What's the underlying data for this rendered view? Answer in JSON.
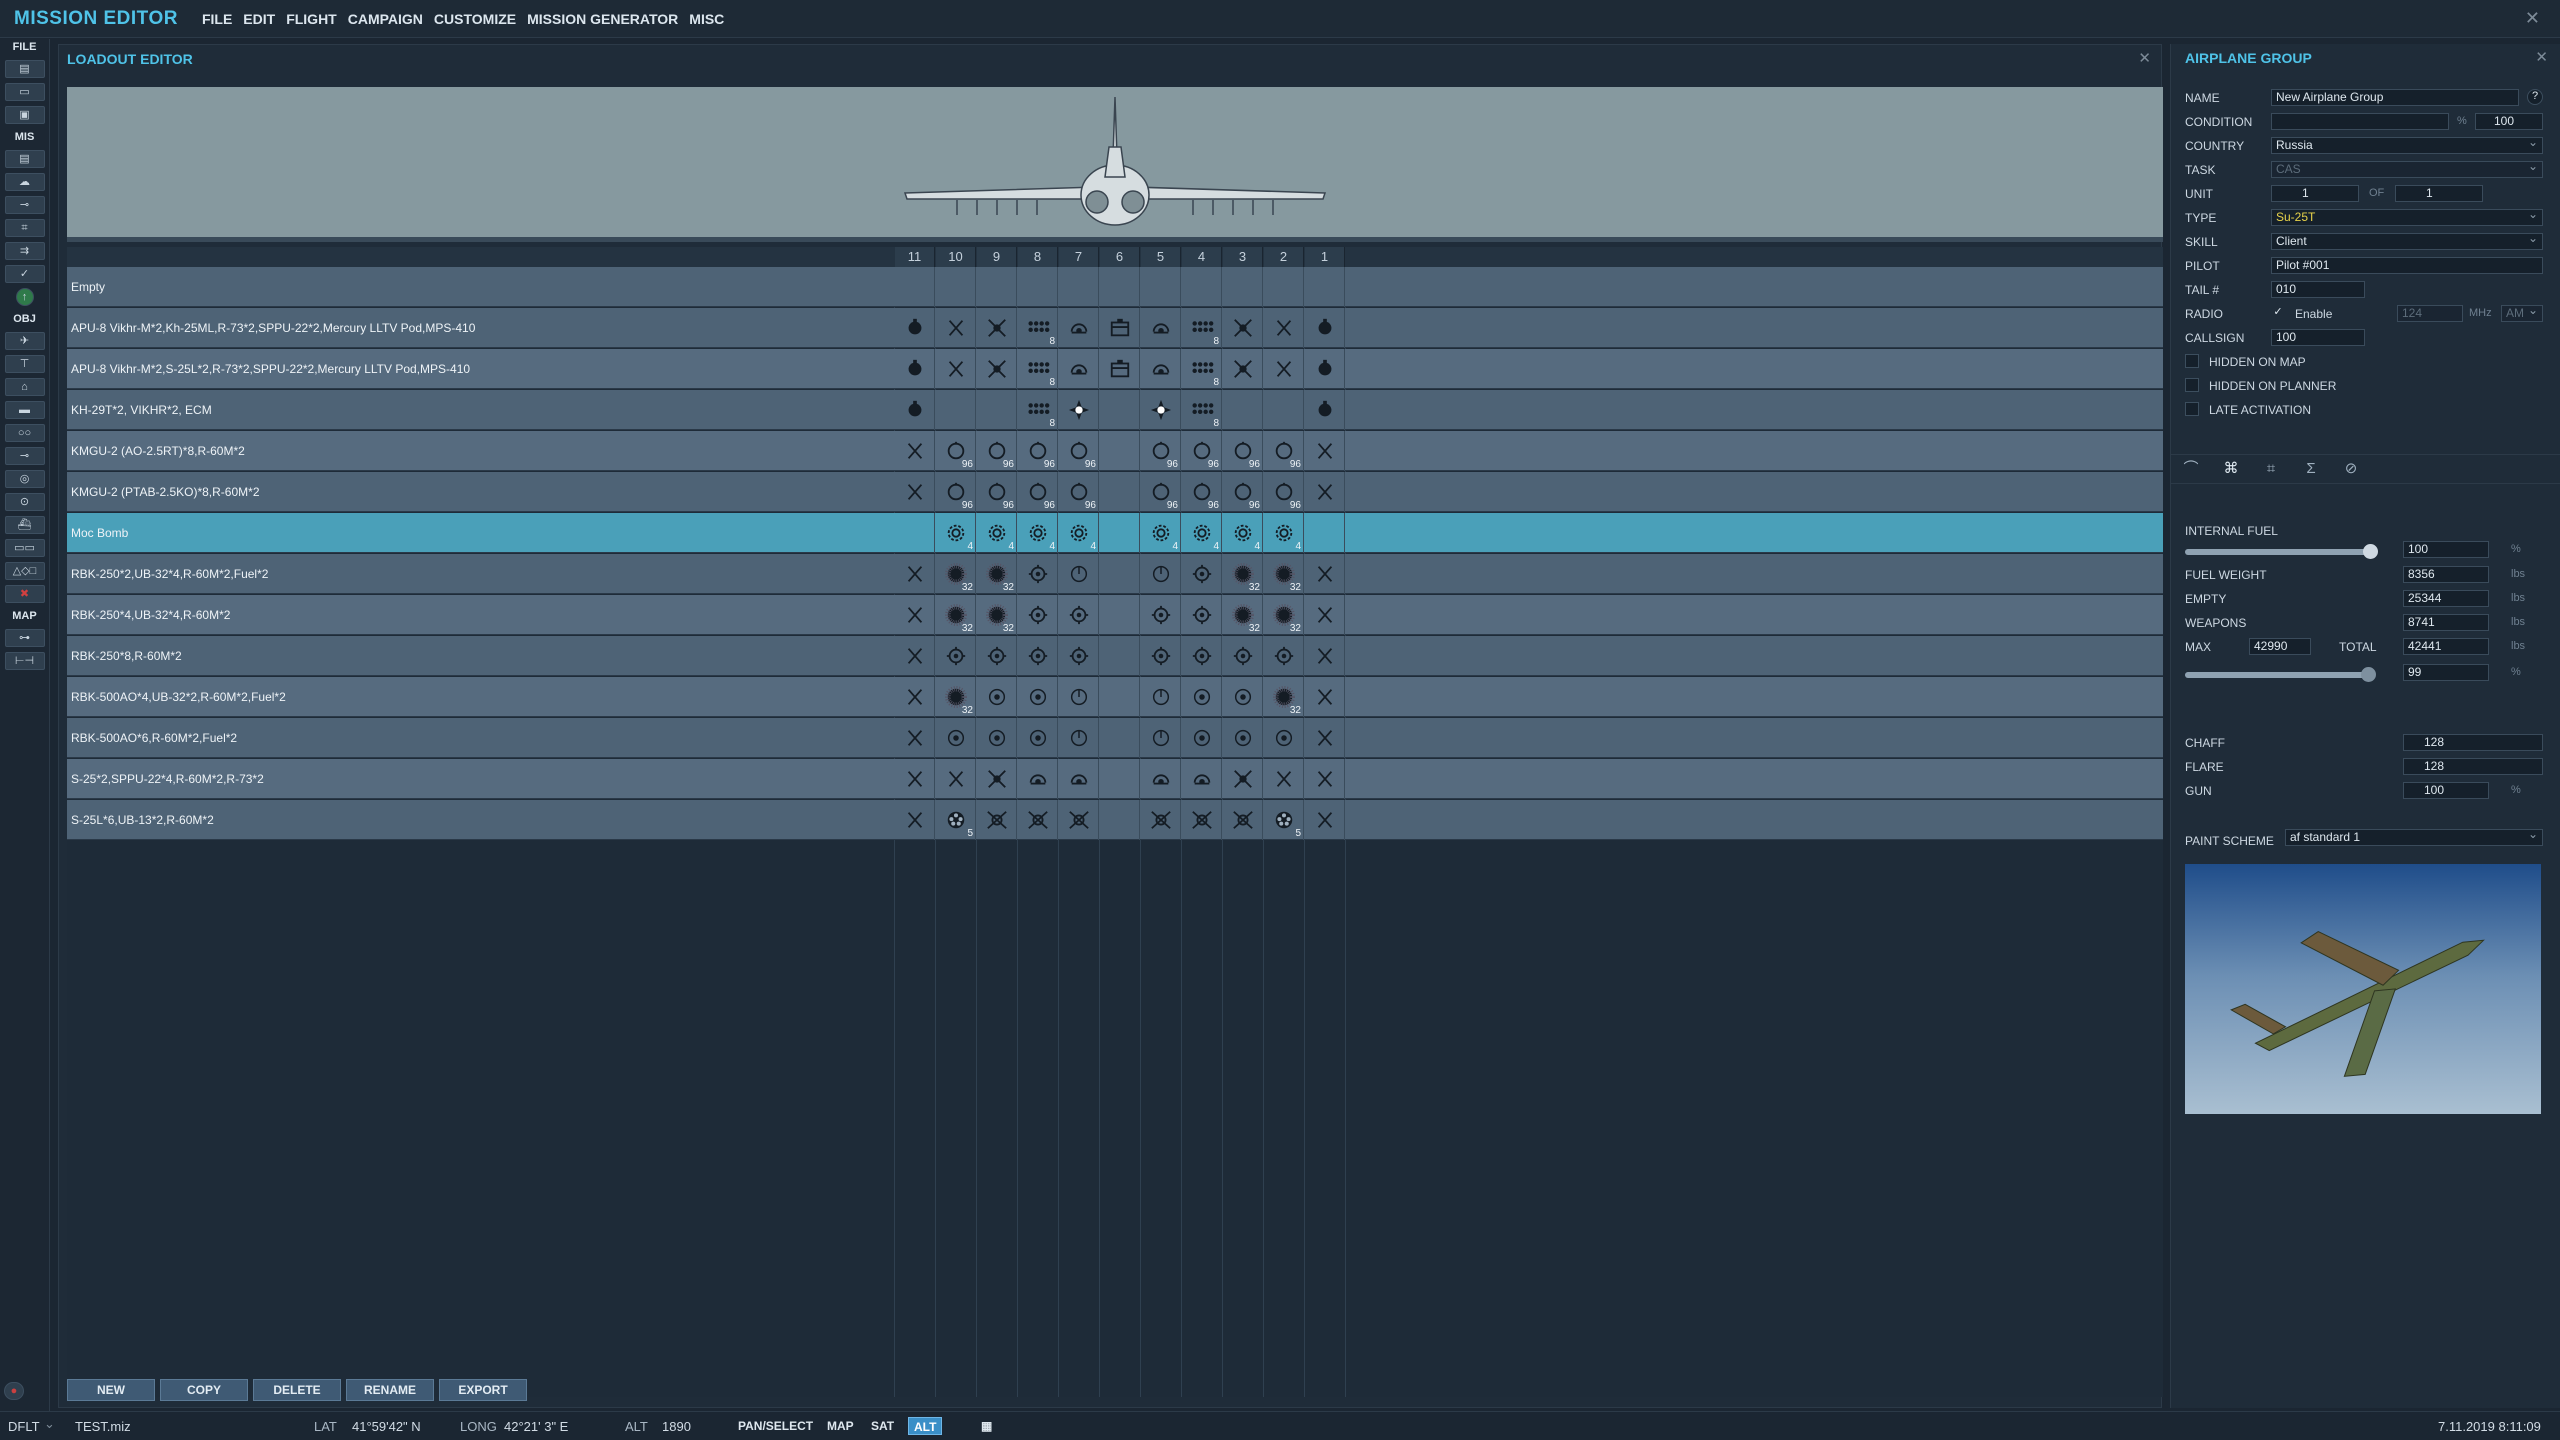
{
  "app": {
    "title": "MISSION EDITOR"
  },
  "menu": [
    "FILE",
    "EDIT",
    "FLIGHT",
    "CAMPAIGN",
    "CUSTOMIZE",
    "MISSION GENERATOR",
    "MISC"
  ],
  "toolbar": {
    "groups": [
      "FILE",
      "MIS",
      "OBJ",
      "MAP"
    ],
    "close": "✕"
  },
  "loadout": {
    "title": "LOADOUT EDITOR",
    "close": "✕",
    "stations": [
      "11",
      "10",
      "9",
      "8",
      "7",
      "6",
      "5",
      "4",
      "3",
      "2",
      "1"
    ],
    "rows": [
      {
        "name": "Empty",
        "slots": [
          "",
          "",
          "",
          "",
          "",
          "",
          "",
          "",
          "",
          "",
          ""
        ]
      },
      {
        "name": "APU-8 Vikhr-M*2,Kh-25ML,R-73*2,SPPU-22*2,Mercury LLTV Pod,MPS-410",
        "slots": [
          "bomb",
          "x",
          "xb",
          "rack8",
          "pod",
          "box",
          "pod",
          "rack8",
          "xb",
          "x",
          "bomb"
        ]
      },
      {
        "name": "APU-8 Vikhr-M*2,S-25L*2,R-73*2,SPPU-22*2,Mercury LLTV Pod,MPS-410",
        "slots": [
          "bomb",
          "x",
          "xb",
          "rack8",
          "pod",
          "box",
          "pod",
          "rack8",
          "xb",
          "x",
          "bomb"
        ]
      },
      {
        "name": "KH-29T*2, VIKHR*2, ECM",
        "slots": [
          "bomb",
          "",
          "",
          "rack8",
          "star",
          "",
          "star",
          "rack8",
          "",
          "",
          "bomb"
        ]
      },
      {
        "name": "KMGU-2 (AO-2.5RT)*8,R-60M*2",
        "slots": [
          "x",
          "pod96",
          "pod96",
          "pod96",
          "pod96",
          "",
          "pod96",
          "pod96",
          "pod96",
          "pod96",
          "x"
        ]
      },
      {
        "name": "KMGU-2 (PTAB-2.5KO)*8,R-60M*2",
        "slots": [
          "x",
          "pod96",
          "pod96",
          "pod96",
          "pod96",
          "",
          "pod96",
          "pod96",
          "pod96",
          "pod96",
          "x"
        ]
      },
      {
        "name": "Moc Bomb",
        "slots": [
          "",
          "gear4",
          "gear4",
          "gear4",
          "gear4",
          "",
          "gear4",
          "gear4",
          "gear4",
          "gear4",
          ""
        ]
      },
      {
        "name": "RBK-250*2,UB-32*4,R-60M*2,Fuel*2",
        "slots": [
          "x",
          "mesh32",
          "mesh32",
          "gear",
          "circ",
          "",
          "circ",
          "gear",
          "mesh32",
          "mesh32",
          "x"
        ]
      },
      {
        "name": "RBK-250*4,UB-32*4,R-60M*2",
        "slots": [
          "x",
          "mesh32",
          "mesh32",
          "gear",
          "gear",
          "",
          "gear",
          "gear",
          "mesh32",
          "mesh32",
          "x"
        ]
      },
      {
        "name": "RBK-250*8,R-60M*2",
        "slots": [
          "x",
          "gear",
          "gear",
          "gear",
          "gear",
          "",
          "gear",
          "gear",
          "gear",
          "gear",
          "x"
        ]
      },
      {
        "name": "RBK-500AO*4,UB-32*2,R-60M*2,Fuel*2",
        "slots": [
          "x",
          "mesh32",
          "ring",
          "ring",
          "circ",
          "",
          "circ",
          "ring",
          "ring",
          "mesh32",
          "x"
        ]
      },
      {
        "name": "RBK-500AO*6,R-60M*2,Fuel*2",
        "slots": [
          "x",
          "ring",
          "ring",
          "ring",
          "circ",
          "",
          "circ",
          "ring",
          "ring",
          "ring",
          "x"
        ]
      },
      {
        "name": "S-25*2,SPPU-22*4,R-60M*2,R-73*2",
        "slots": [
          "x",
          "x",
          "xb",
          "pod",
          "pod",
          "",
          "pod",
          "pod",
          "xb",
          "x",
          "x"
        ]
      },
      {
        "name": "S-25L*6,UB-13*2,R-60M*2",
        "slots": [
          "x",
          "flower5",
          "xc",
          "xc",
          "xc",
          "",
          "xc",
          "xc",
          "xc",
          "flower5",
          "x"
        ]
      }
    ],
    "buttons": [
      "NEW",
      "COPY",
      "DELETE",
      "RENAME",
      "EXPORT"
    ]
  },
  "group": {
    "title": "AIRPLANE GROUP",
    "close": "✕",
    "name_label": "NAME",
    "name_value": "New Airplane Group",
    "help": "?",
    "condition_label": "CONDITION",
    "condition_unit": "%",
    "condition_value": "100",
    "country_label": "COUNTRY",
    "country_value": "Russia",
    "task_label": "TASK",
    "task_value": "CAS",
    "unit_label": "UNIT",
    "unit_value": "1",
    "of_label": "OF",
    "of_value": "1",
    "type_label": "TYPE",
    "type_value": "Su-25T",
    "skill_label": "SKILL",
    "skill_value": "Client",
    "pilot_label": "PILOT",
    "pilot_value": "Pilot #001",
    "tail_label": "TAIL #",
    "tail_value": "010",
    "radio_label": "RADIO",
    "radio_enable": "Enable",
    "radio_freq": "124",
    "radio_unit": "MHz",
    "radio_mod": "AM",
    "callsign_label": "CALLSIGN",
    "callsign_value": "100",
    "hidden_map": "HIDDEN ON MAP",
    "hidden_planner": "HIDDEN ON PLANNER",
    "late_activation": "LATE ACTIVATION",
    "radio_checked": true
  },
  "payload": {
    "internal_fuel_label": "INTERNAL FUEL",
    "internal_fuel_value": "100",
    "internal_fuel_unit": "%",
    "internal_fuel_fraction": 1.0,
    "fuel_weight_label": "FUEL WEIGHT",
    "fuel_weight_value": "8356",
    "empty_label": "EMPTY",
    "empty_value": "25344",
    "weapons_label": "WEAPONS",
    "weapons_value": "8741",
    "max_label": "MAX",
    "max_value": "42990",
    "total_label": "TOTAL",
    "total_value": "42441",
    "total_pct_value": "99",
    "total_fraction": 0.99,
    "lbs": "lbs",
    "pct": "%",
    "chaff_label": "CHAFF",
    "chaff_value": "128",
    "flare_label": "FLARE",
    "flare_value": "128",
    "gun_label": "GUN",
    "gun_value": "100",
    "gun_unit": "%",
    "paint_label": "PAINT SCHEME",
    "paint_value": "af standard 1"
  },
  "status": {
    "profile": "DFLT",
    "file": "TEST.miz",
    "lat_label": "LAT",
    "lat_value": "41°59'42\" N",
    "long_label": "LONG",
    "long_value": "42°21' 3\" E",
    "alt_label": "ALT",
    "alt_value": "1890",
    "pan": "PAN/SELECT",
    "map": "MAP",
    "sat": "SAT",
    "alt_btn": "ALT",
    "datetime": "7.11.2019 8:11:09"
  },
  "colors": {
    "accent": "#4fc3e8",
    "selected_row": "#4aa0b9",
    "type_value": "#e7d24a"
  }
}
